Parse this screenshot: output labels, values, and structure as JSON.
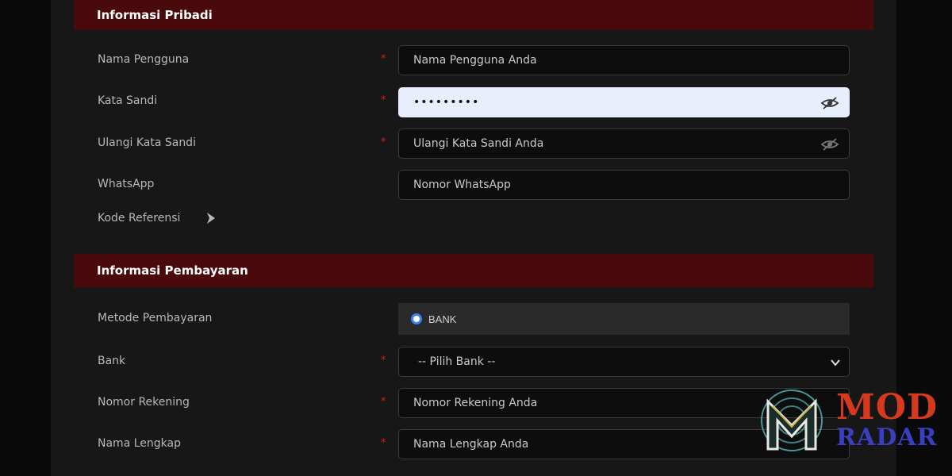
{
  "sections": {
    "personal_title": "Informasi Pribadi",
    "payment_title": "Informasi Pembayaran"
  },
  "personal": {
    "username": {
      "label": "Nama Pengguna",
      "required": "*",
      "placeholder": "Nama Pengguna Anda"
    },
    "password": {
      "label": "Kata Sandi",
      "required": "*",
      "value": "•••••••••"
    },
    "confirm_password": {
      "label": "Ulangi Kata Sandi",
      "required": "*",
      "placeholder": "Ulangi Kata Sandi Anda"
    },
    "whatsapp": {
      "label": "WhatsApp",
      "placeholder": "Nomor WhatsApp"
    },
    "referral": {
      "label": "Kode Referensi"
    }
  },
  "payment": {
    "method": {
      "label": "Metode Pembayaran",
      "option": "BANK"
    },
    "bank": {
      "label": "Bank",
      "required": "*",
      "selected": "-- Pilih Bank --"
    },
    "account_number": {
      "label": "Nomor Rekening",
      "required": "*",
      "placeholder": "Nomor Rekening Anda"
    },
    "full_name": {
      "label": "Nama Lengkap",
      "required": "*",
      "placeholder": "Nama Lengkap Anda"
    }
  },
  "watermark": {
    "line1": "MOD",
    "line2": "RADAR"
  },
  "colors": {
    "header_bg": "#4a0a0b",
    "required": "#e01818",
    "radio": "#3b82f6",
    "logo_red": "#d63a1e",
    "logo_blue": "#3a3fc2"
  },
  "icons": {
    "eye": "eye-slash-icon",
    "arrow": "chevron-right-icon",
    "caret": "chevron-down-icon"
  }
}
